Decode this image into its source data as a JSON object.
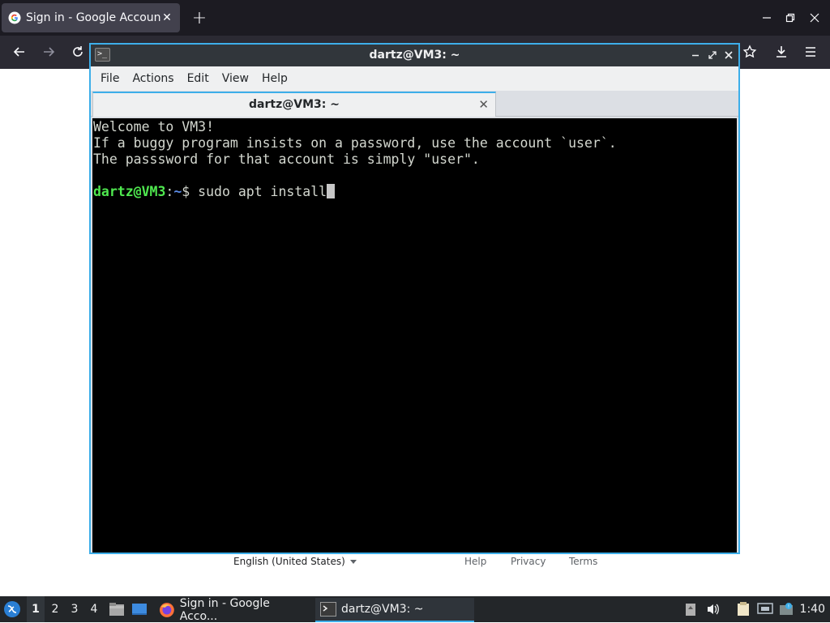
{
  "browser": {
    "tab_title": "Sign in - Google Accounts",
    "new_tab_icon": "+",
    "minimize_icon": "minimize-icon",
    "restore_icon": "restore-icon",
    "close_icon": "close-icon"
  },
  "google_footer": {
    "language": "English (United States)",
    "help": "Help",
    "privacy": "Privacy",
    "terms": "Terms"
  },
  "terminal": {
    "window_title": "dartz@VM3: ~",
    "menu": [
      "File",
      "Actions",
      "Edit",
      "View",
      "Help"
    ],
    "tab_title": "dartz@VM3: ~",
    "lines": [
      "Welcome to VM3!",
      "If a buggy program insists on a password, use the account `user`.",
      "The passsword for that account is simply \"user\".",
      ""
    ],
    "prompt_user": "dartz@VM3",
    "prompt_sep": ":",
    "prompt_path": "~",
    "prompt_symbol": "$ ",
    "command": "sudo apt install"
  },
  "taskbar": {
    "workspaces": [
      "1",
      "2",
      "3",
      "4"
    ],
    "active_workspace": "1",
    "tasks": [
      {
        "label": "Sign in - Google Acco...",
        "icon": "firefox-icon"
      },
      {
        "label": "dartz@VM3: ~",
        "icon": "terminal-icon"
      }
    ],
    "clock": "1:40"
  },
  "colors": {
    "accent": "#3daee9",
    "prompt_user": "#4fe84f",
    "prompt_path": "#5c8de8"
  }
}
